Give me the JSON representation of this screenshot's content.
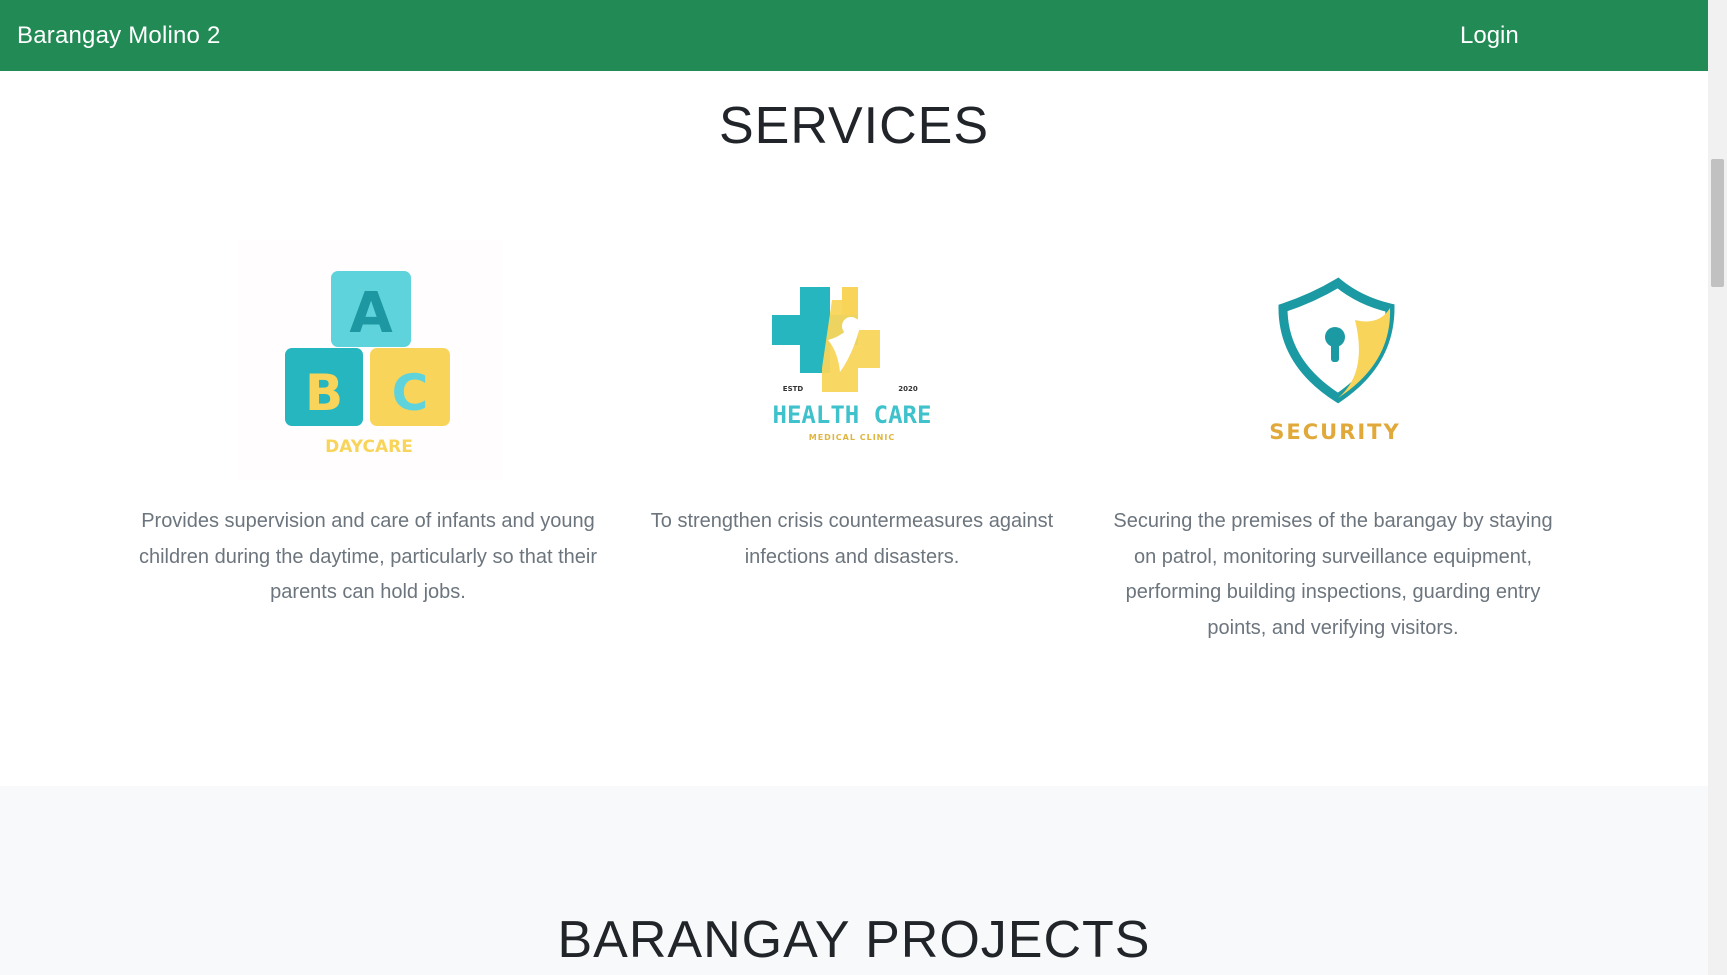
{
  "navbar": {
    "brand": "Barangay Molino 2",
    "login_label": "Login"
  },
  "services": {
    "title": "SERVICES",
    "cards": [
      {
        "logo_text": "DAYCARE",
        "block_letters": [
          "A",
          "B",
          "C"
        ],
        "text": "Provides supervision and care of infants and young children during the daytime, particularly so that their parents can hold jobs."
      },
      {
        "logo_text": "HEALTH CARE",
        "logo_subtext": "MEDICAL CLINIC",
        "logo_left": "ESTD",
        "logo_right": "2020",
        "text": "To strengthen crisis countermeasures against infections and disasters."
      },
      {
        "logo_text": "SECURITY",
        "text": "Securing the premises of the barangay by staying on patrol, monitoring surveillance equipment, performing building inspections, guarding entry points, and verifying visitors."
      }
    ]
  },
  "projects": {
    "title": "BARANGAY PROJECTS"
  },
  "colors": {
    "navbar": "#218a55",
    "teal": "#2bb3bb",
    "yellow": "#f8d55a",
    "gold": "#e0a93a"
  }
}
